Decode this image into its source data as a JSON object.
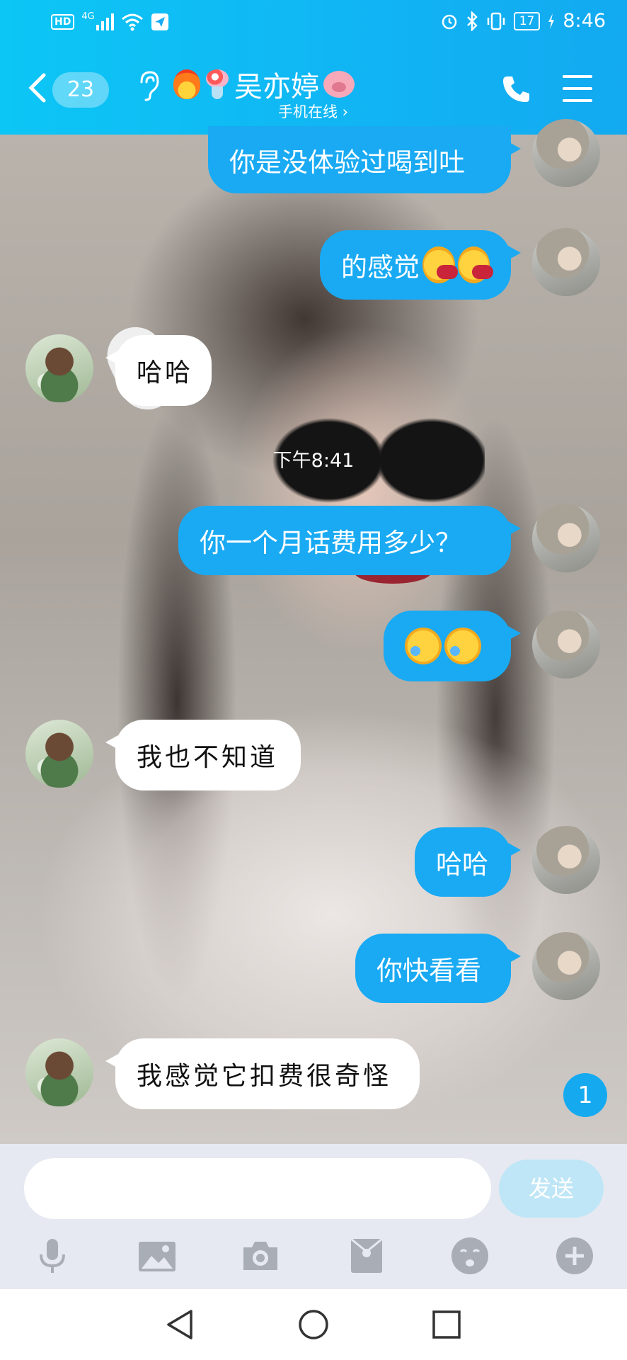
{
  "status_bar": {
    "network_badge": "HD",
    "network_type": "4G",
    "battery": "17",
    "time": "8:46"
  },
  "header": {
    "back_count": "23",
    "contact_name": "吴亦婷",
    "contact_status": "手机在线 ›"
  },
  "messages": [
    {
      "side": "out",
      "text": "你是没体验过喝到吐"
    },
    {
      "side": "out",
      "text": "的感觉",
      "emoji": [
        "sweat-kiss-emoji",
        "sweat-kiss-emoji"
      ]
    },
    {
      "side": "in",
      "text": "哈哈"
    },
    {
      "side": "out",
      "text": "你一个月话费用多少？"
    },
    {
      "side": "out",
      "text": "",
      "emoji": [
        "laugh-cry-emoji",
        "facepalm-emoji"
      ]
    },
    {
      "side": "in",
      "text": "我也不知道"
    },
    {
      "side": "out",
      "text": "哈哈"
    },
    {
      "side": "out",
      "text": "你快看看"
    },
    {
      "side": "in",
      "text": "我感觉它扣费很奇怪"
    }
  ],
  "timestamp": "下午8:41",
  "unread_count": "1",
  "composer": {
    "input_value": "",
    "send_label": "发送"
  },
  "toolbar": [
    "microphone-icon",
    "image-icon",
    "camera-icon",
    "red-packet-icon",
    "emoji-icon",
    "plus-icon"
  ],
  "colors": {
    "header": "#0cc6f5",
    "outgoing_bubble": "#19aaf3",
    "incoming_bubble": "#ffffff",
    "send_button_disabled": "#bfe6f6"
  }
}
